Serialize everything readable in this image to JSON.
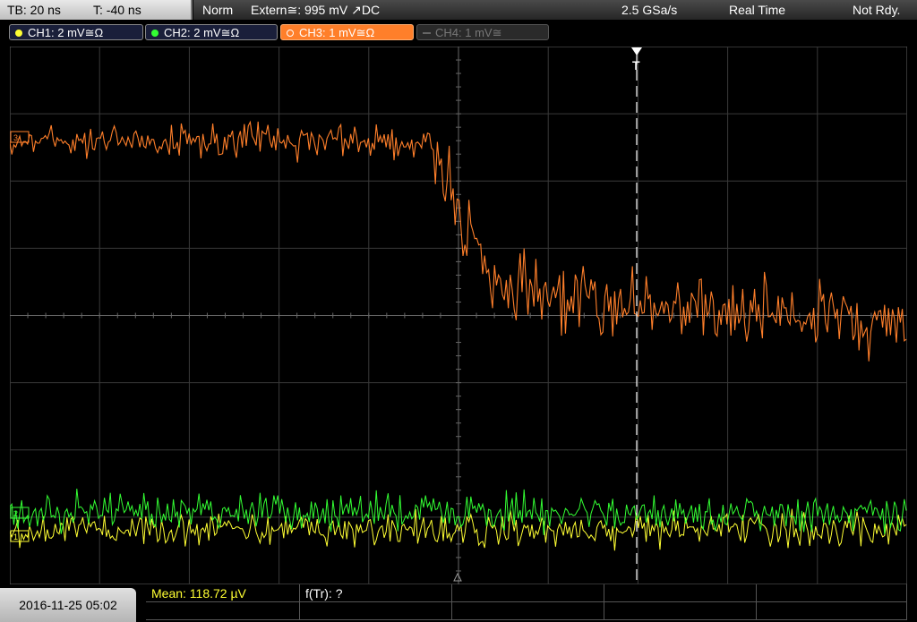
{
  "top": {
    "timebase": "TB: 20 ns",
    "trigger_time": "T: -40 ns",
    "trigger_mode": "Norm",
    "trigger_source": "Extern≅: 995 mV ↗DC",
    "sample_rate": "2.5 GSa/s",
    "acq_mode": "Real Time",
    "status": "Not Rdy."
  },
  "channels": [
    {
      "label": "CH1: 2 mV≅Ω",
      "color": "#ffff33",
      "active": true
    },
    {
      "label": "CH2: 2 mV≅Ω",
      "color": "#33ff33",
      "active": true
    },
    {
      "label": "CH3: 1 mV≅Ω",
      "color": "#ff7f2a",
      "active": true,
      "selected": true
    },
    {
      "label": "CH4: 1 mV≅",
      "color": "#666666",
      "active": false
    }
  ],
  "trigger_marker": "T",
  "bottom": {
    "date": "2016-11-25 05:02",
    "measurement1": "Mean: 118.72 µV",
    "measurement2": "f(Tr): ?"
  },
  "colors": {
    "ch1": "#ffff33",
    "ch2": "#33ff33",
    "ch3": "#ff7f2a",
    "grid": "#555555"
  }
}
